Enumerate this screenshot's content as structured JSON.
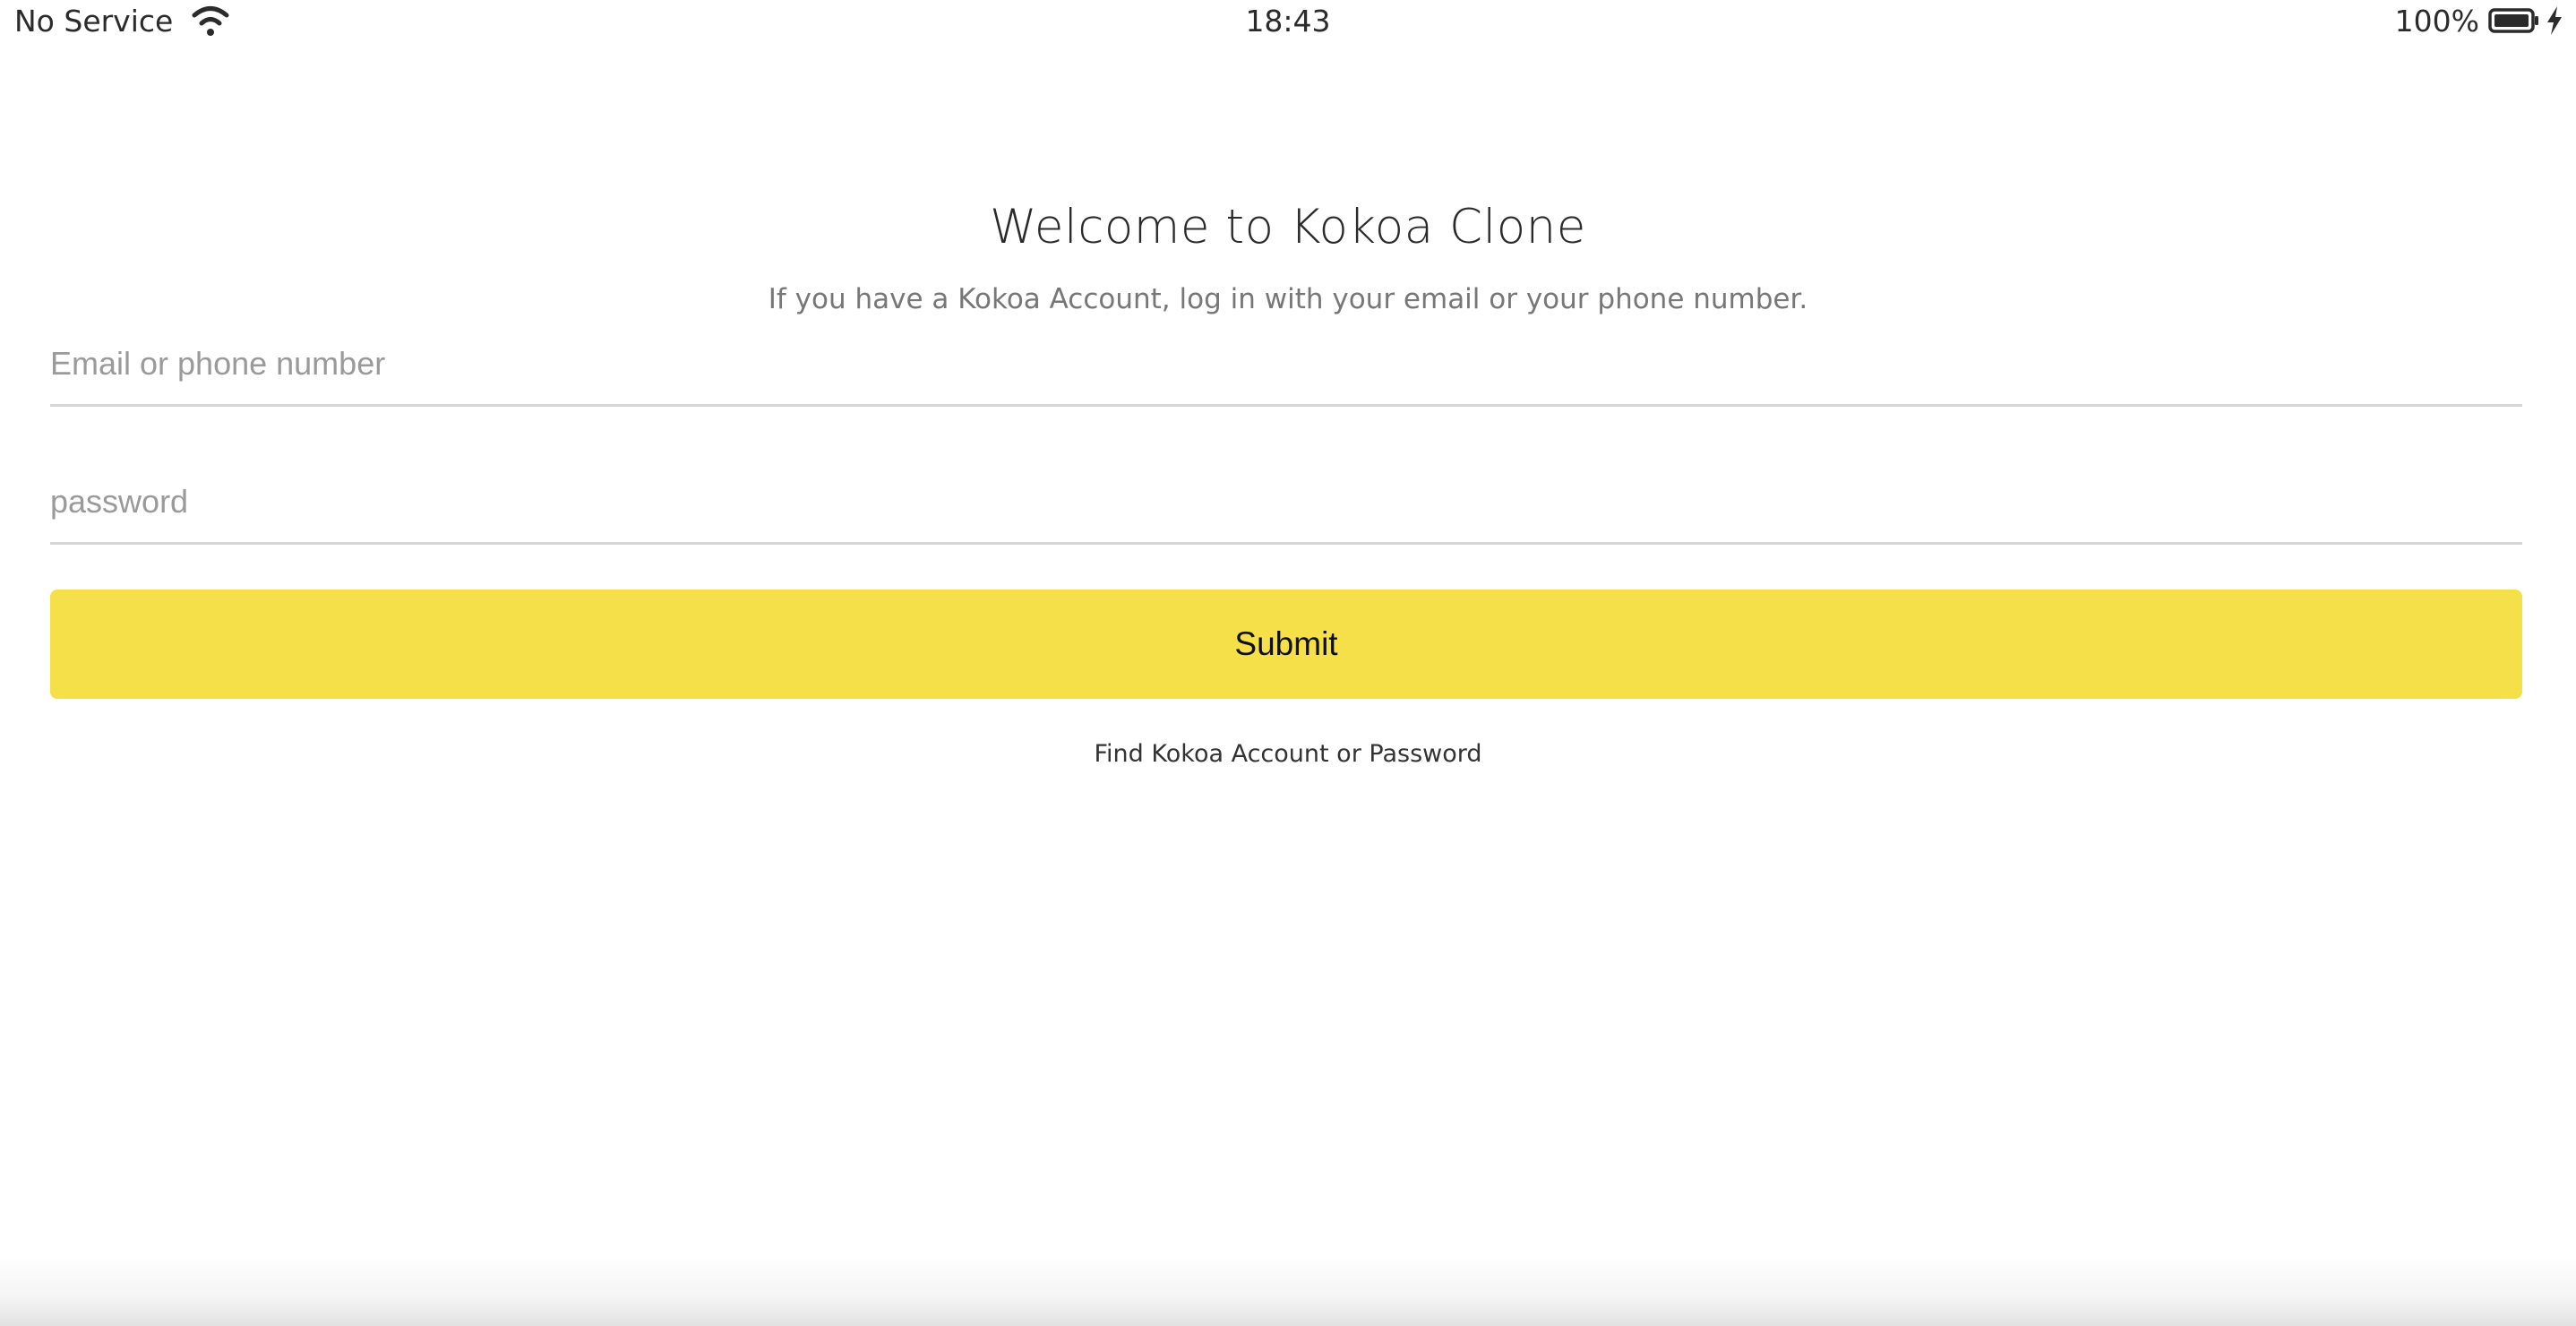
{
  "status_bar": {
    "carrier": "No Service",
    "time": "18:43",
    "battery_percent": "100%",
    "wifi_icon": "wifi-icon",
    "battery_icon": "battery-full-icon",
    "charging_icon": "charging-bolt-icon"
  },
  "welcome": {
    "title": "Welcome to Kokoa Clone",
    "subtitle": "If you have a Kokoa Account, log in with your email or your phone number."
  },
  "form": {
    "email_placeholder": "Email or phone number",
    "email_value": "",
    "password_placeholder": "password",
    "password_value": "",
    "submit_label": "Submit",
    "submit_color": "#f5e04a"
  },
  "find_link": "Find Kokoa Account or Password"
}
